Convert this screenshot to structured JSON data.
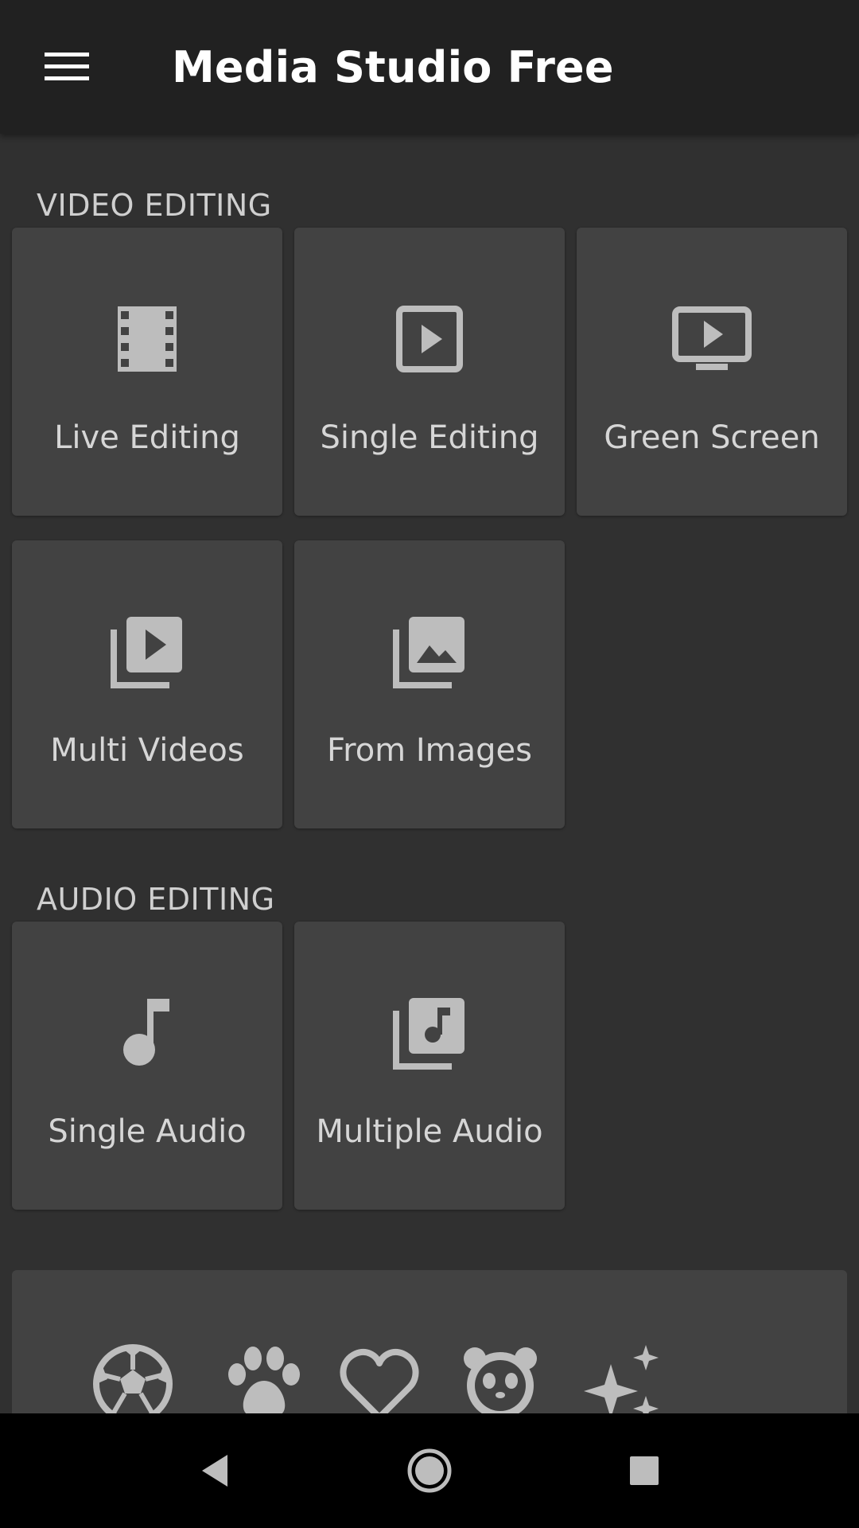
{
  "app": {
    "title": "Media Studio Free"
  },
  "colors": {
    "appbar": "#212121",
    "background": "#303030",
    "tile": "#424242",
    "icon": "#bdbdbd",
    "label": "#d6d6d6",
    "navbar": "#000000"
  },
  "sections": {
    "video": {
      "title": "VIDEO EDITING",
      "tiles": [
        {
          "label": "Live Editing",
          "icon": "movie-film-icon"
        },
        {
          "label": "Single Editing",
          "icon": "play-square-icon"
        },
        {
          "label": "Green Screen",
          "icon": "tv-play-icon"
        },
        {
          "label": "Multi Videos",
          "icon": "video-library-icon"
        },
        {
          "label": "From Images",
          "icon": "photo-library-icon"
        }
      ]
    },
    "audio": {
      "title": "AUDIO EDITING",
      "tiles": [
        {
          "label": "Single Audio",
          "icon": "music-note-icon"
        },
        {
          "label": "Multiple Audio",
          "icon": "music-library-icon"
        }
      ]
    }
  },
  "stickers": {
    "icons": [
      "soccer-ball-icon",
      "paw-icon",
      "heart-icon",
      "panda-icon",
      "sparkles-icon"
    ]
  },
  "navigation": {
    "icons": [
      "back-icon",
      "home-icon",
      "recents-icon"
    ]
  }
}
